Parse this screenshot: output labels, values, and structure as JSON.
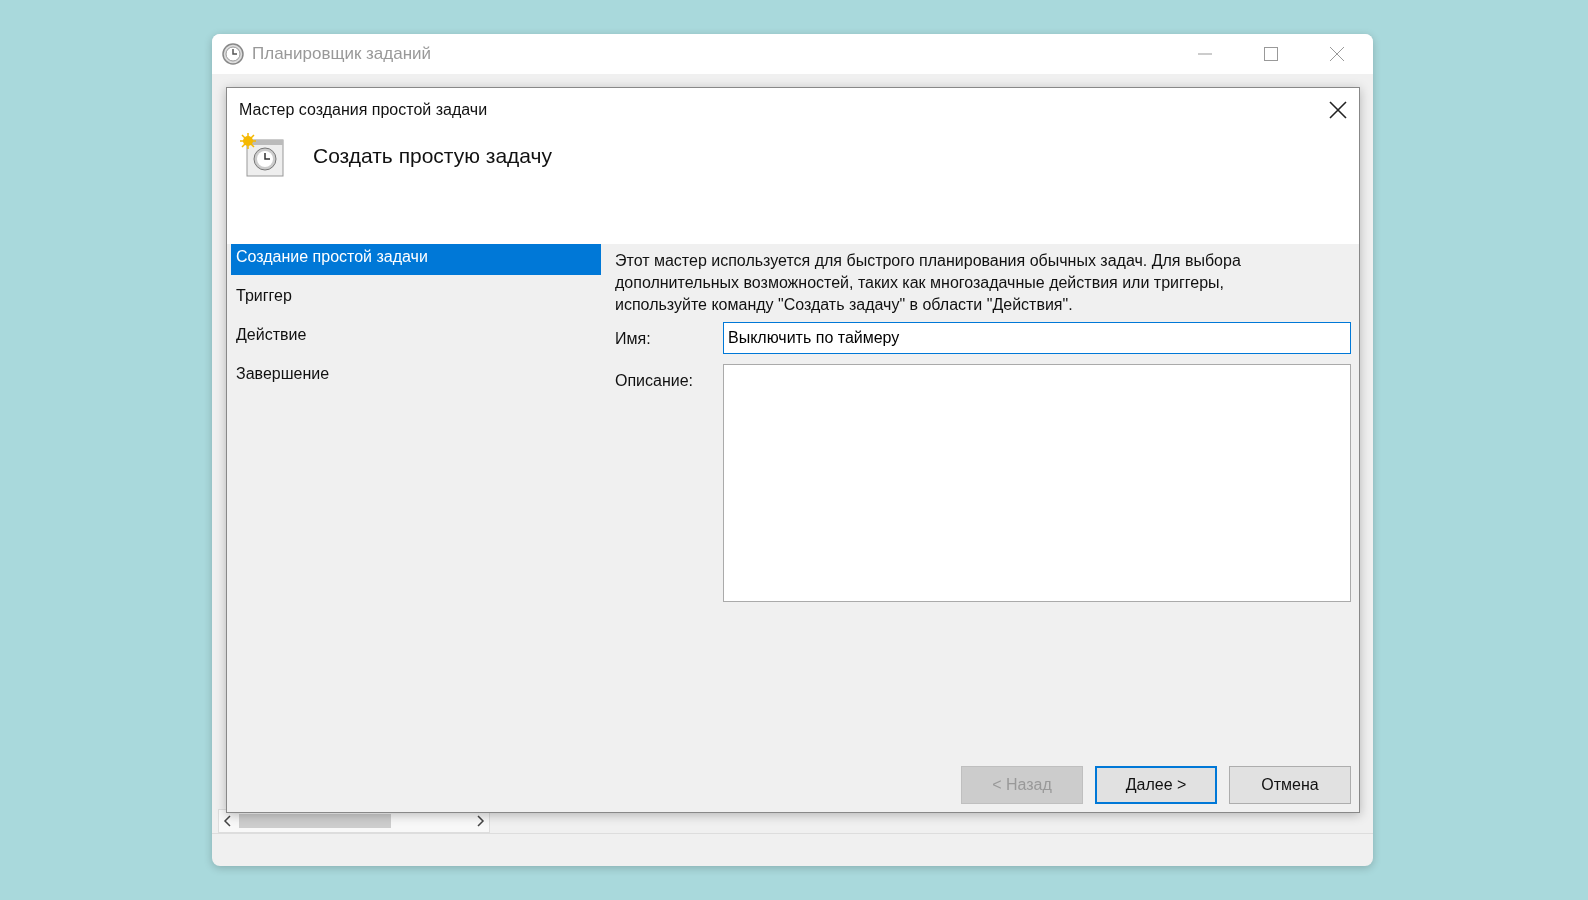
{
  "main_window": {
    "title": "Планировщик заданий"
  },
  "dialog": {
    "title": "Мастер создания простой задачи",
    "heading": "Создать простую задачу",
    "steps": [
      {
        "label": "Создание простой задачи",
        "selected": true
      },
      {
        "label": "Триггер",
        "selected": false
      },
      {
        "label": "Действие",
        "selected": false
      },
      {
        "label": "Завершение",
        "selected": false
      }
    ],
    "intro": "Этот мастер используется для быстрого планирования обычных задач.  Для выбора дополнительных возможностей, таких как многозадачные действия или триггеры, используйте команду \"Создать задачу\" в области \"Действия\".",
    "fields": [
      {
        "kind": "line",
        "label": "Имя:",
        "value": "Выключить по таймеру",
        "focused": true
      },
      {
        "kind": "multiline",
        "label": "Описание:",
        "focused": false
      }
    ],
    "buttons": [
      {
        "label": "< Назад",
        "disabled": true,
        "default": false
      },
      {
        "label": "Далее >",
        "disabled": false,
        "default": true
      },
      {
        "label": "Отмена",
        "disabled": false,
        "default": false
      }
    ]
  }
}
